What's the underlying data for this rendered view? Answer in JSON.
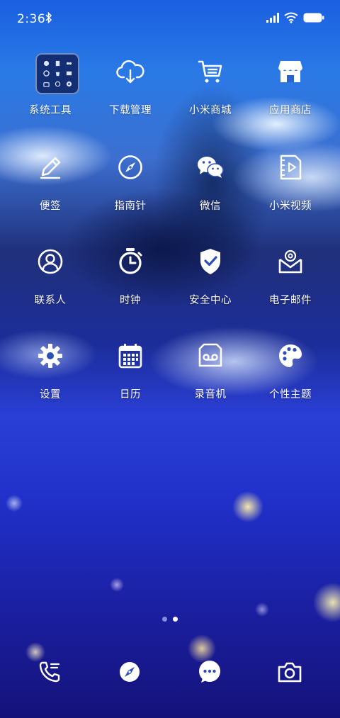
{
  "status_bar": {
    "time": "2:36",
    "icons": [
      "bluetooth-icon",
      "signal-icon",
      "wifi-icon",
      "battery-icon"
    ]
  },
  "home": {
    "apps": [
      {
        "label": "系统工具",
        "icon": "folder-icon"
      },
      {
        "label": "下载管理",
        "icon": "cloud-download-icon"
      },
      {
        "label": "小米商城",
        "icon": "cart-icon"
      },
      {
        "label": "应用商店",
        "icon": "store-icon"
      },
      {
        "label": "便签",
        "icon": "pencil-icon"
      },
      {
        "label": "指南针",
        "icon": "compass-icon"
      },
      {
        "label": "微信",
        "icon": "wechat-icon"
      },
      {
        "label": "小米视频",
        "icon": "video-file-icon"
      },
      {
        "label": "联系人",
        "icon": "contact-icon"
      },
      {
        "label": "时钟",
        "icon": "stopwatch-icon"
      },
      {
        "label": "安全中心",
        "icon": "shield-check-icon"
      },
      {
        "label": "电子邮件",
        "icon": "mail-at-icon"
      },
      {
        "label": "设置",
        "icon": "gear-icon"
      },
      {
        "label": "日历",
        "icon": "calendar-icon"
      },
      {
        "label": "录音机",
        "icon": "recorder-icon"
      },
      {
        "label": "个性主题",
        "icon": "palette-icon"
      }
    ]
  },
  "page_indicator": {
    "pages": 2,
    "current": 2
  },
  "dock": {
    "icons": [
      "phone-icon",
      "browser-compass-icon",
      "message-icon",
      "camera-icon"
    ]
  },
  "colors": {
    "text": "#ffffff",
    "folder_bg": "#122869",
    "dot_inactive": "#7f8fd8",
    "dot_active": "#ffffff"
  }
}
